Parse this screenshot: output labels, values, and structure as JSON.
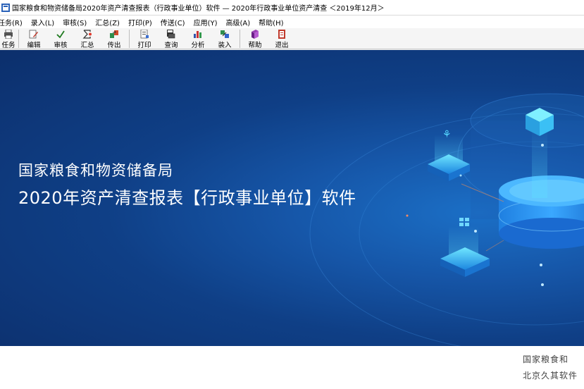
{
  "window": {
    "title": "国家粮食和物资储备局2020年资产清查报表（行政事业单位）软件 — 2020年行政事业单位资产清查 ＜2019年12月＞"
  },
  "menu": [
    {
      "label": "任务(R)"
    },
    {
      "label": "录入(L)"
    },
    {
      "label": "审核(S)"
    },
    {
      "label": "汇总(Z)"
    },
    {
      "label": "打印(P)"
    },
    {
      "label": "传送(C)"
    },
    {
      "label": "应用(Y)"
    },
    {
      "label": "高级(A)"
    },
    {
      "label": "帮助(H)"
    }
  ],
  "toolbar": [
    {
      "label": "任务",
      "icon": "printer-icon"
    },
    {
      "label": "编辑",
      "icon": "edit-icon"
    },
    {
      "label": "审核",
      "icon": "check-icon"
    },
    {
      "label": "汇总",
      "icon": "sum-icon"
    },
    {
      "label": "传出",
      "icon": "export-icon"
    },
    {
      "label": "打印",
      "icon": "print-icon"
    },
    {
      "label": "查询",
      "icon": "query-icon"
    },
    {
      "label": "分析",
      "icon": "chart-icon"
    },
    {
      "label": "装入",
      "icon": "import-icon"
    },
    {
      "label": "帮助",
      "icon": "help-book-icon"
    },
    {
      "label": "退出",
      "icon": "exit-icon"
    }
  ],
  "banner": {
    "org": "国家粮食和物资储备局",
    "title": "2020年资产清查报表【行政事业单位】软件"
  },
  "footer": {
    "line1": "国家粮食和",
    "line2": "北京久其软件"
  },
  "colors": {
    "banner_dark": "#0c2f6c",
    "banner_mid": "#1656a8",
    "banner_light": "#1b6fc6",
    "accent_cyan": "#3fd0ff"
  }
}
